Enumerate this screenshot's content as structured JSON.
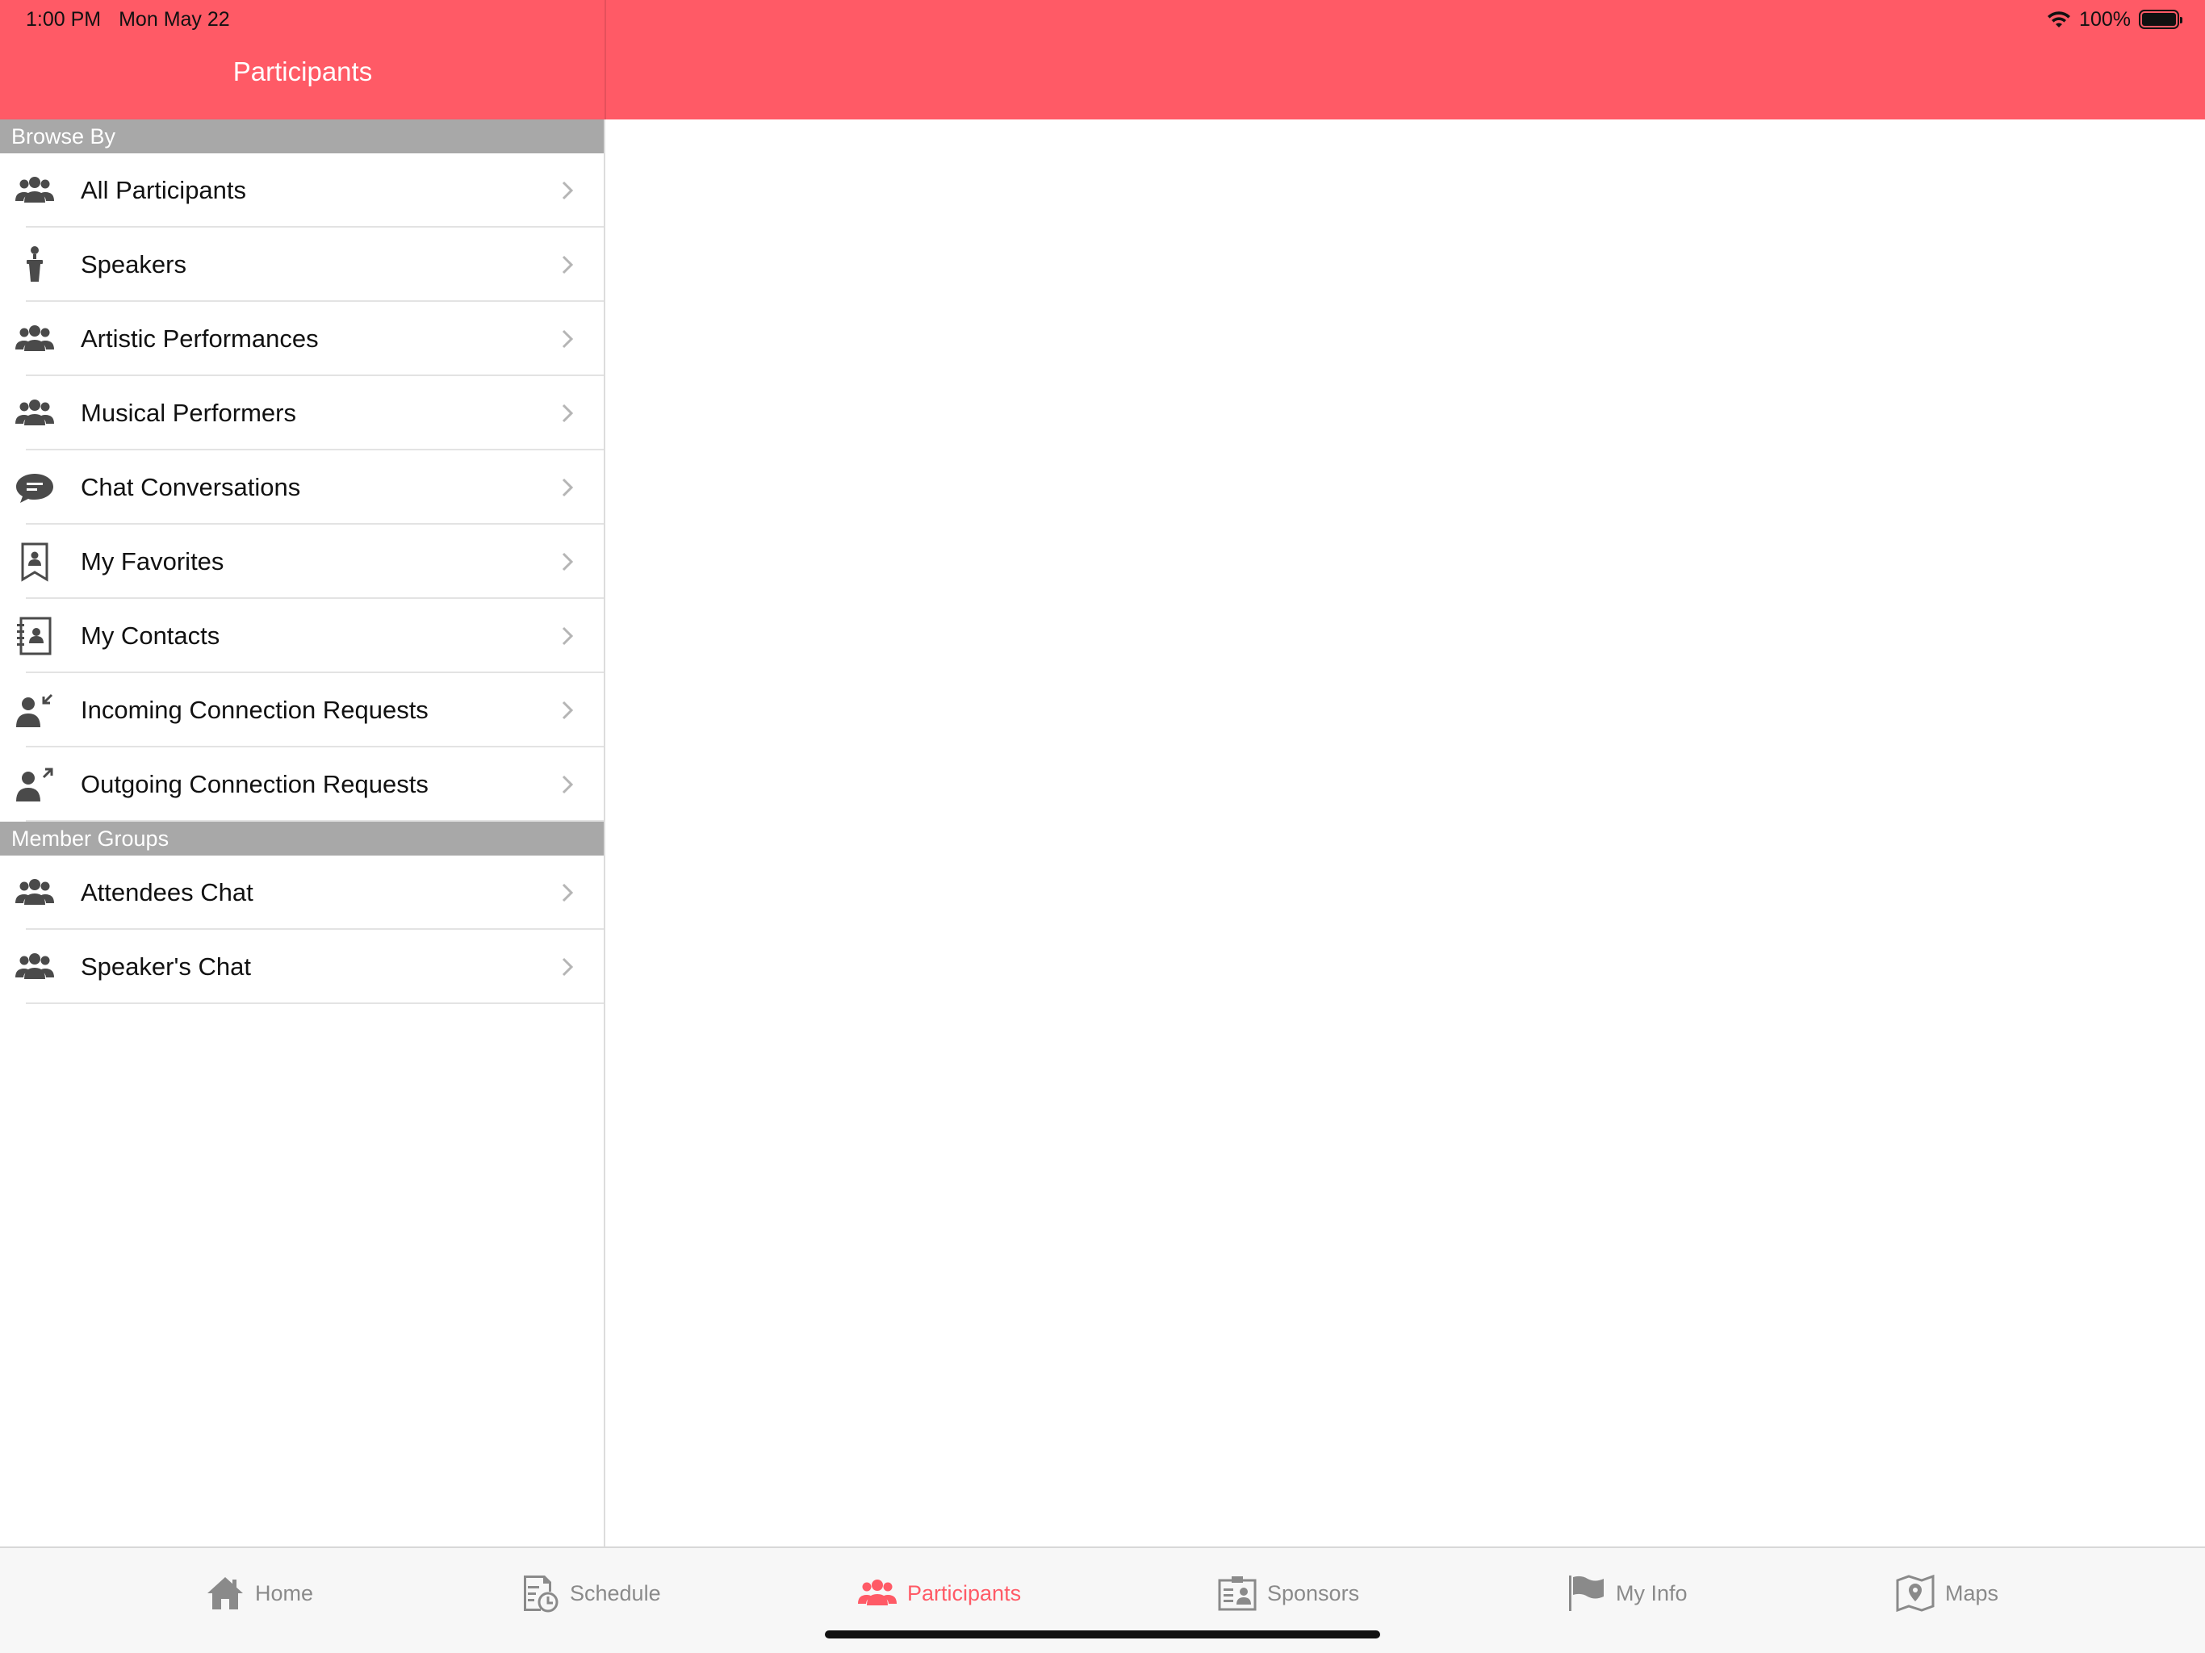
{
  "status_bar": {
    "time": "1:00 PM",
    "date": "Mon May 22",
    "battery_percent": "100%",
    "battery_level": 1.0
  },
  "header": {
    "title": "Participants"
  },
  "colors": {
    "accent": "#ff5a66",
    "section_header": "#a8a8a8",
    "icon": "#4a4a4a",
    "tab_inactive": "#8a8a8a"
  },
  "sidebar": {
    "sections": [
      {
        "title": "Browse By",
        "items": [
          {
            "label": "All Participants",
            "icon": "group-icon"
          },
          {
            "label": "Speakers",
            "icon": "podium-speaker-icon"
          },
          {
            "label": "Artistic Performances",
            "icon": "group-icon"
          },
          {
            "label": "Musical Performers",
            "icon": "group-icon"
          },
          {
            "label": "Chat Conversations",
            "icon": "chat-bubble-icon"
          },
          {
            "label": "My Favorites",
            "icon": "bookmark-person-icon"
          },
          {
            "label": "My Contacts",
            "icon": "address-book-icon"
          },
          {
            "label": "Incoming Connection Requests",
            "icon": "person-incoming-arrow-icon"
          },
          {
            "label": "Outgoing Connection Requests",
            "icon": "person-outgoing-arrow-icon"
          }
        ]
      },
      {
        "title": "Member Groups",
        "items": [
          {
            "label": "Attendees Chat",
            "icon": "group-icon"
          },
          {
            "label": "Speaker's Chat",
            "icon": "group-icon"
          }
        ]
      }
    ]
  },
  "tabbar": {
    "tabs": [
      {
        "label": "Home",
        "icon": "home-icon",
        "active": false
      },
      {
        "label": "Schedule",
        "icon": "schedule-icon",
        "active": false
      },
      {
        "label": "Participants",
        "icon": "participants-icon",
        "active": true
      },
      {
        "label": "Sponsors",
        "icon": "sponsors-icon",
        "active": false
      },
      {
        "label": "My Info",
        "icon": "flag-icon",
        "active": false
      },
      {
        "label": "Maps",
        "icon": "map-icon",
        "active": false
      }
    ]
  }
}
